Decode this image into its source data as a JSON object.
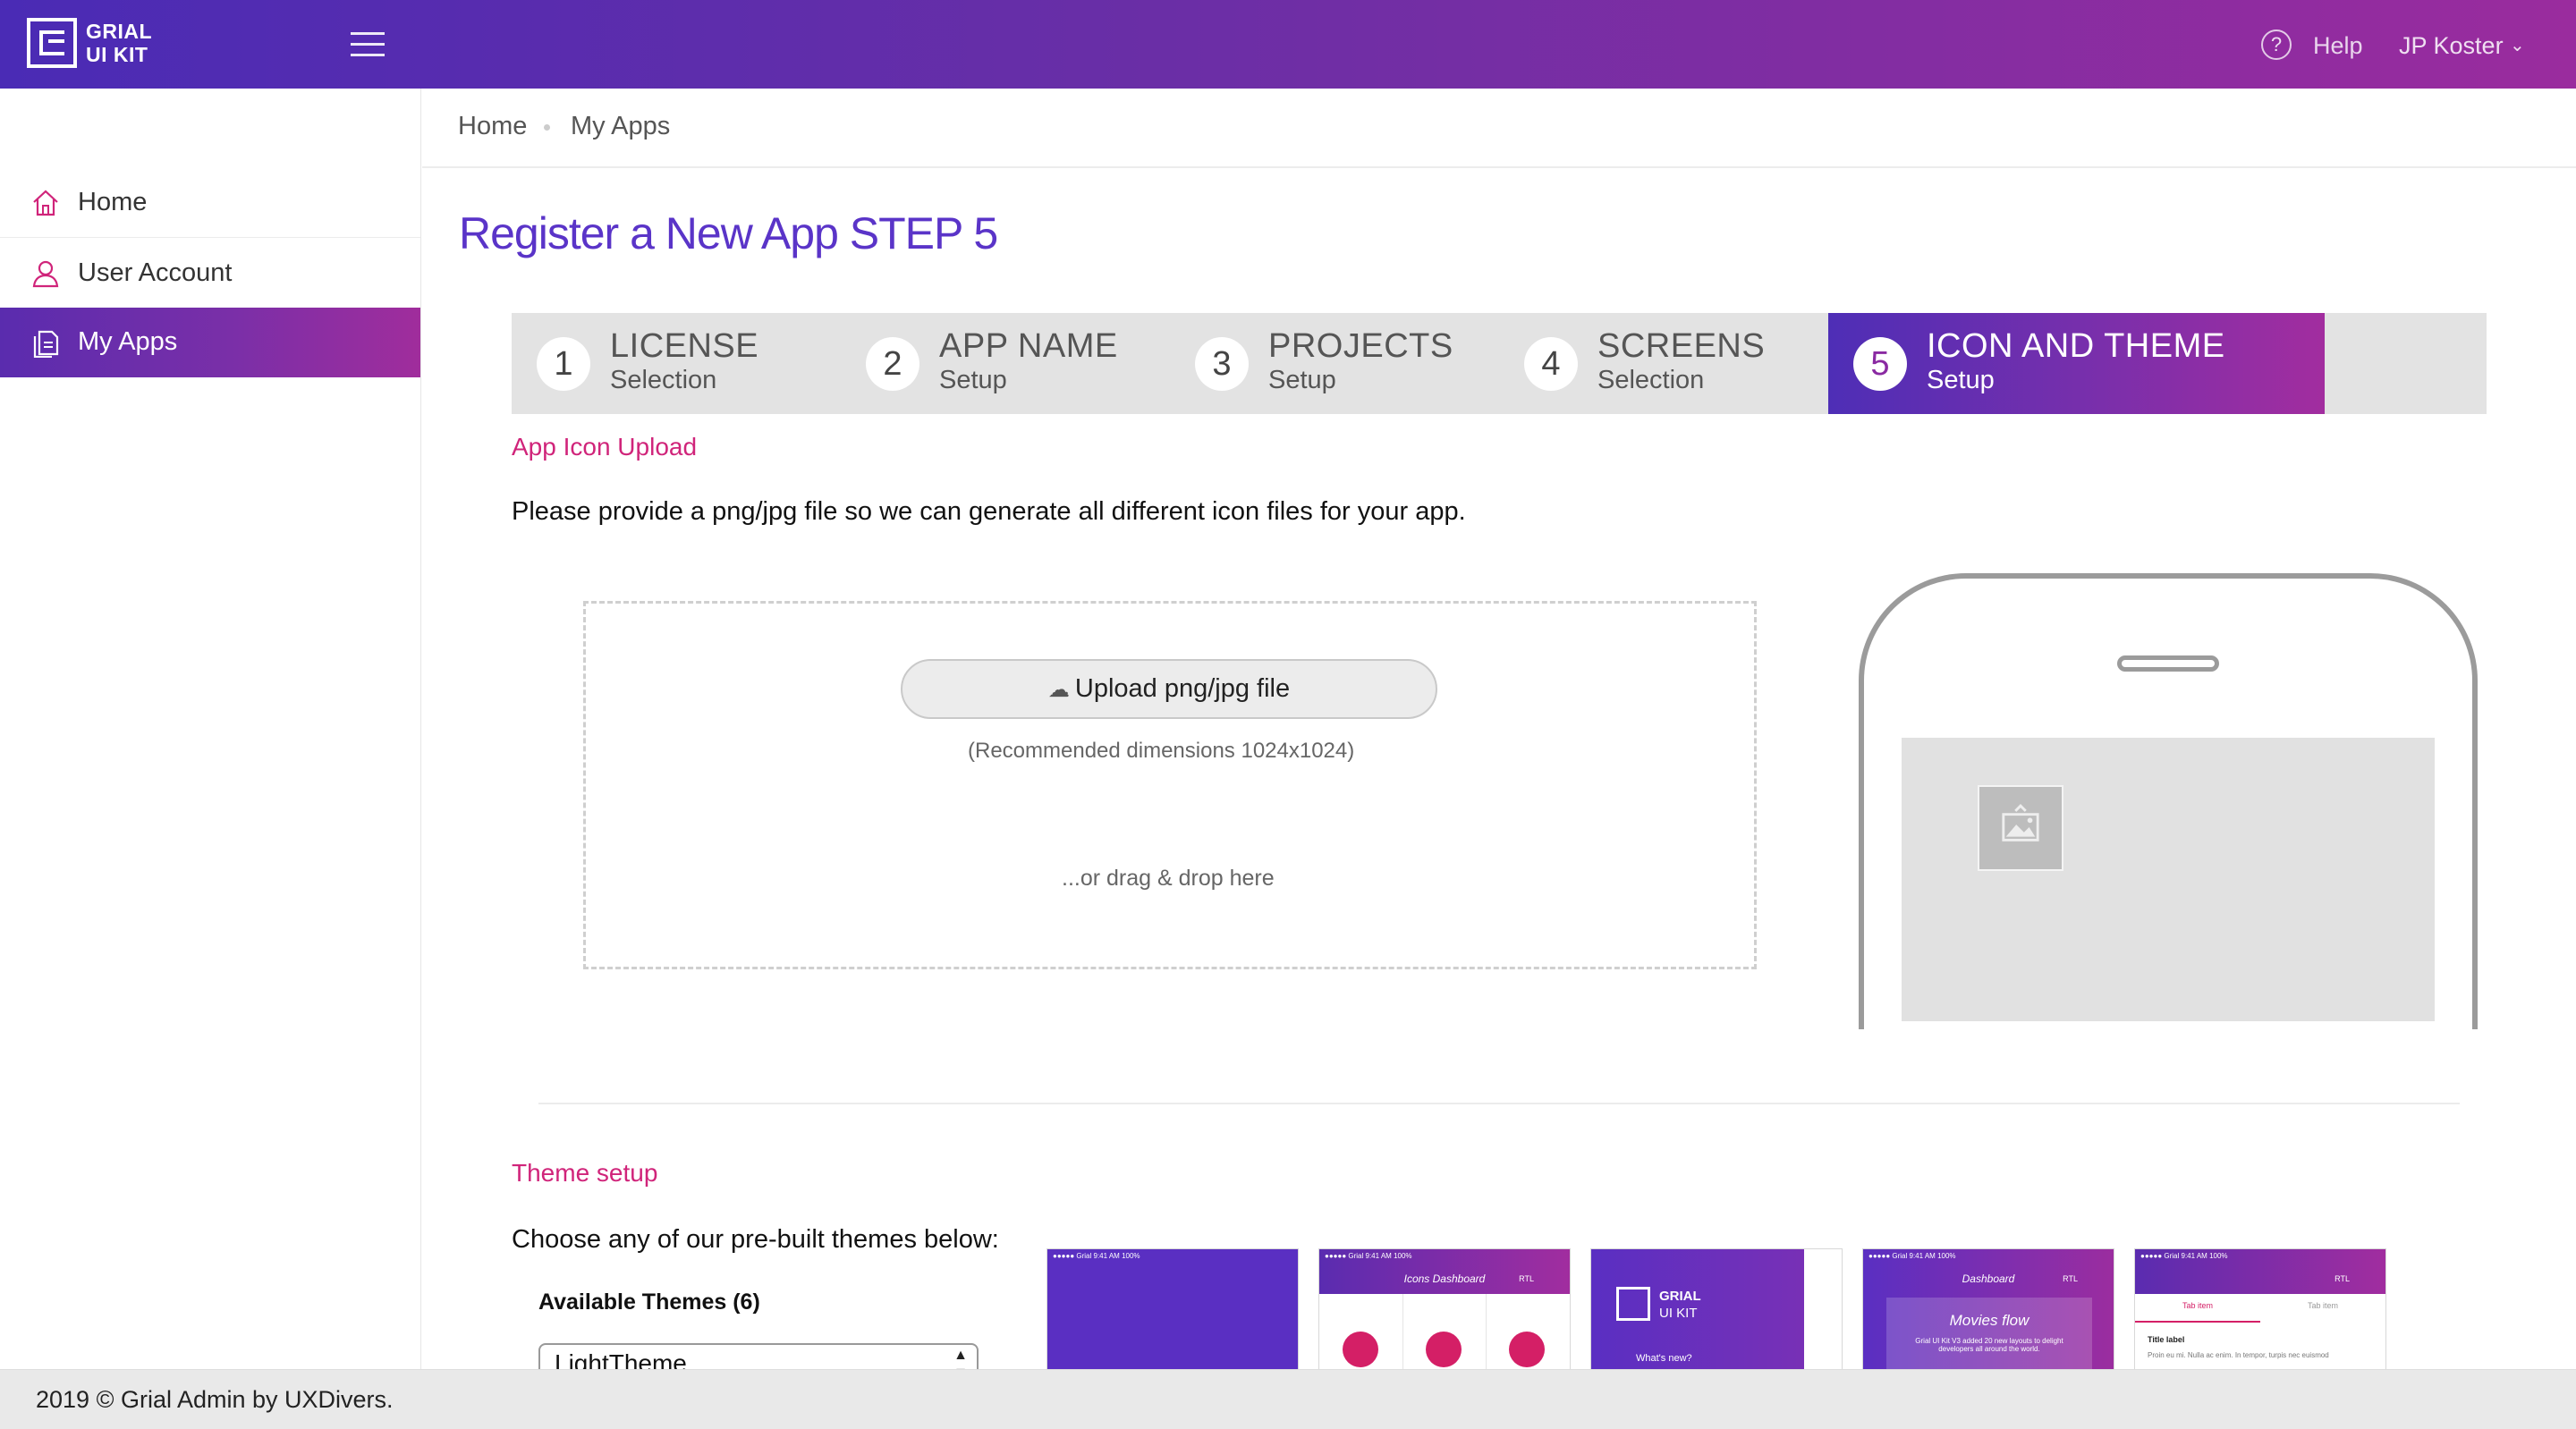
{
  "app": {
    "logo_line1": "GRIAL",
    "logo_line2": "UI KIT"
  },
  "topbar": {
    "help_label": "Help",
    "user_name": "JP Koster"
  },
  "sidebar": {
    "items": [
      {
        "label": "Home",
        "icon": "home-icon"
      },
      {
        "label": "User Account",
        "icon": "user-icon"
      },
      {
        "label": "My Apps",
        "icon": "documents-icon",
        "active": true
      }
    ]
  },
  "breadcrumb": {
    "items": [
      "Home",
      "My Apps"
    ]
  },
  "page": {
    "title": "Register a New App STEP 5"
  },
  "steps": [
    {
      "num": "1",
      "title": "LICENSE",
      "subtitle": "Selection"
    },
    {
      "num": "2",
      "title": "APP NAME",
      "subtitle": "Setup"
    },
    {
      "num": "3",
      "title": "PROJECTS",
      "subtitle": "Setup"
    },
    {
      "num": "4",
      "title": "SCREENS",
      "subtitle": "Selection"
    },
    {
      "num": "5",
      "title": "ICON AND THEME",
      "subtitle": "Setup",
      "active": true
    }
  ],
  "icon_upload": {
    "section_title": "App Icon Upload",
    "description": "Please provide a png/jpg file so we can generate all different icon files for your app.",
    "upload_button": "Upload png/jpg file",
    "recommended": "(Recommended dimensions 1024x1024)",
    "drag_hint": "...or drag & drop here"
  },
  "theme": {
    "section_title": "Theme setup",
    "description": "Choose any of our pre-built themes below:",
    "available_label": "Available Themes (6)",
    "selected": "LightTheme",
    "thumbnails": [
      {
        "status": "●●●●● Grial  9:41 AM  100%"
      },
      {
        "status": "●●●●● Grial  9:41 AM  100%",
        "header": "Icons Dashboard",
        "rtl": "RTL"
      },
      {
        "logo1": "GRIAL",
        "logo2": "UI KIT",
        "caption": "What's new?"
      },
      {
        "status": "●●●●● Grial  9:41 AM  100%",
        "header": "Dashboard",
        "rtl": "RTL",
        "card": "Movies flow",
        "card_text": "Grial UI Kit V3 added 20 new layouts to delight developers all around the world."
      },
      {
        "status": "●●●●● Grial  9:41 AM  100%",
        "rtl": "RTL",
        "tab1": "Tab item",
        "tab2": "Tab item",
        "title_label": "Title label",
        "body": "Proin eu mi. Nulla ac enim. In tempor, turpis nec euismod"
      }
    ]
  },
  "footer": {
    "text": "2019 © Grial Admin by UXDivers."
  },
  "colors": {
    "accent": "#5a34c8",
    "brand_gradient_start": "#4a2bb5",
    "brand_gradient_end": "#a02d9c",
    "section_title": "#d0247a"
  }
}
